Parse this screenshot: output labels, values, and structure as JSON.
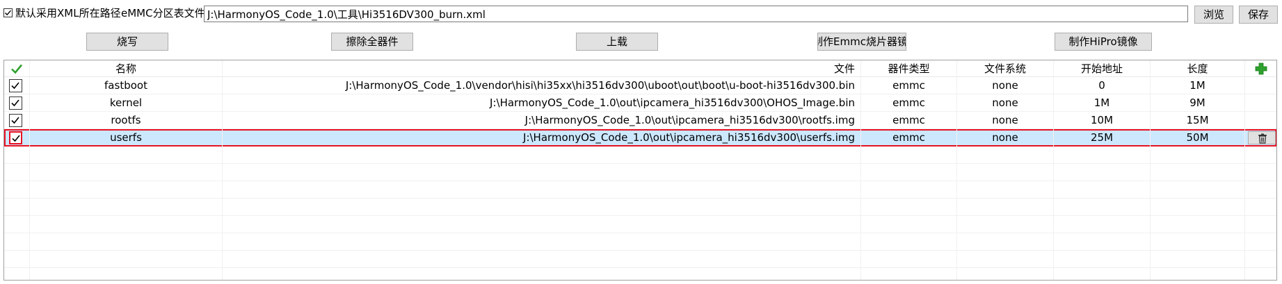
{
  "toolbar": {
    "use_xml_path_label": "默认采用XML所在路径",
    "use_xml_path_checked": true,
    "partition_file_label": "eMMC分区表文件",
    "partition_file_value": "J:\\HarmonyOS_Code_1.0\\工具\\Hi3516DV300_burn.xml",
    "browse_label": "浏览",
    "save_label": "保存"
  },
  "actions": {
    "burn": "烧写",
    "erase_all": "擦除全器件",
    "upload": "上载",
    "make_emmc_image": "制作Emmc烧片器镜像",
    "make_hipro_image": "制作HiPro镜像"
  },
  "table": {
    "headers": {
      "name": "名称",
      "file": "文件",
      "device_type": "器件类型",
      "filesystem": "文件系统",
      "start_address": "开始地址",
      "length": "长度"
    },
    "rows": [
      {
        "checked": true,
        "name": "fastboot",
        "file": "J:\\HarmonyOS_Code_1.0\\vendor\\hisi\\hi35xx\\hi3516dv300\\uboot\\out\\boot\\u-boot-hi3516dv300.bin",
        "device_type": "emmc",
        "filesystem": "none",
        "start_address": "0",
        "length": "1M",
        "selected": false
      },
      {
        "checked": true,
        "name": "kernel",
        "file": "J:\\HarmonyOS_Code_1.0\\out\\ipcamera_hi3516dv300\\OHOS_Image.bin",
        "device_type": "emmc",
        "filesystem": "none",
        "start_address": "1M",
        "length": "9M",
        "selected": false
      },
      {
        "checked": true,
        "name": "rootfs",
        "file": "J:\\HarmonyOS_Code_1.0\\out\\ipcamera_hi3516dv300\\rootfs.img",
        "device_type": "emmc",
        "filesystem": "none",
        "start_address": "10M",
        "length": "15M",
        "selected": false
      },
      {
        "checked": true,
        "name": "userfs",
        "file": "J:\\HarmonyOS_Code_1.0\\out\\ipcamera_hi3516dv300\\userfs.img",
        "device_type": "emmc",
        "filesystem": "none",
        "start_address": "25M",
        "length": "50M",
        "selected": true
      }
    ]
  },
  "icons": {
    "header_check": "green-check-icon",
    "add": "green-plus-icon",
    "delete": "trash-icon"
  },
  "colors": {
    "selection_bg": "#cce8ff",
    "selection_border": "#e81123",
    "button_bg": "#e1e1e1",
    "accent_green": "#2ea12e"
  }
}
